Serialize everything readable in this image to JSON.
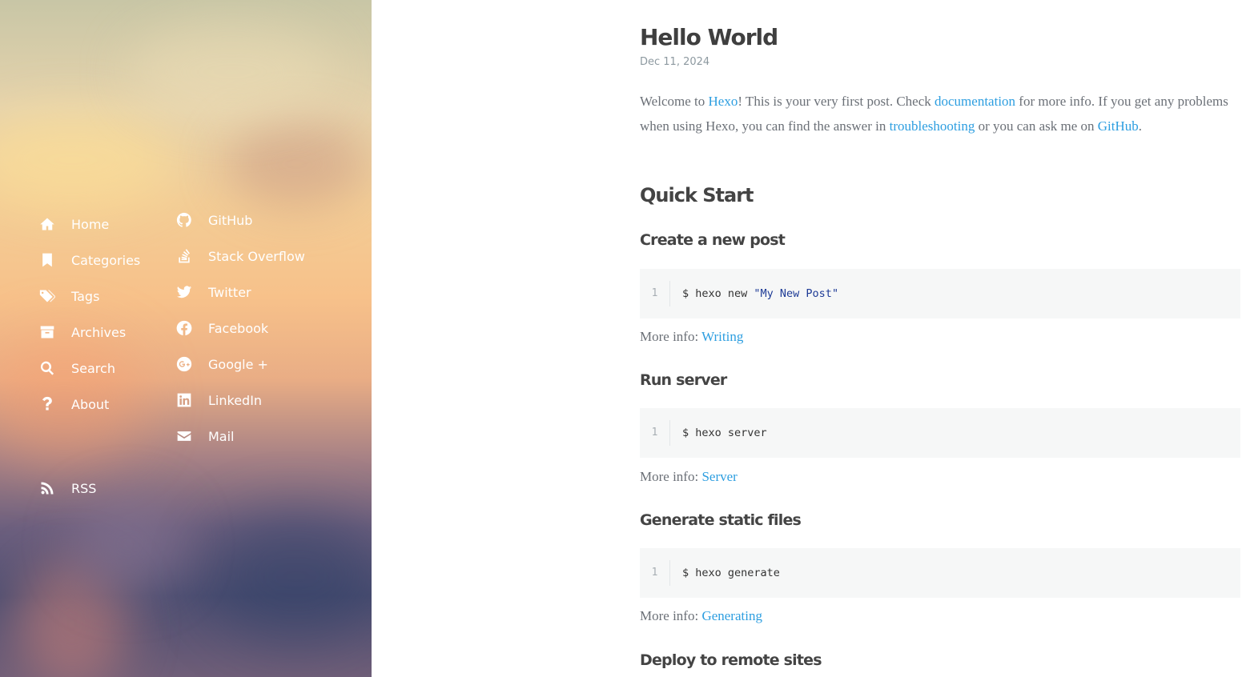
{
  "sidebar": {
    "menu": [
      {
        "label": "Home",
        "icon": "home-icon"
      },
      {
        "label": "Categories",
        "icon": "bookmark-icon"
      },
      {
        "label": "Tags",
        "icon": "tags-icon"
      },
      {
        "label": "Archives",
        "icon": "archive-icon"
      },
      {
        "label": "Search",
        "icon": "search-icon"
      },
      {
        "label": "About",
        "icon": "question-icon"
      }
    ],
    "rss": {
      "label": "RSS",
      "icon": "rss-icon"
    },
    "social": [
      {
        "label": "GitHub",
        "icon": "github-icon"
      },
      {
        "label": "Stack Overflow",
        "icon": "stack-overflow-icon"
      },
      {
        "label": "Twitter",
        "icon": "twitter-icon"
      },
      {
        "label": "Facebook",
        "icon": "facebook-icon"
      },
      {
        "label": "Google +",
        "icon": "google-plus-icon"
      },
      {
        "label": "LinkedIn",
        "icon": "linkedin-icon"
      },
      {
        "label": "Mail",
        "icon": "mail-icon"
      }
    ]
  },
  "post": {
    "title": "Hello World",
    "date": "Dec 11, 2024",
    "intro": {
      "t1": "Welcome to ",
      "link_hexo": "Hexo",
      "t2": "! This is your very first post. Check ",
      "link_docs": "documentation",
      "t3": " for more info. If you get any problems when using Hexo, you can find the answer in ",
      "link_trouble": "troubleshooting",
      "t4": " or you can ask me on ",
      "link_github": "GitHub",
      "t5": "."
    },
    "quick_start": "Quick Start",
    "more_info_label": "More info: ",
    "sections": [
      {
        "heading": "Create a new post",
        "line_no": "1",
        "cmd": "$ hexo new ",
        "cmd_str": "\"My New Post\"",
        "more_link": "Writing"
      },
      {
        "heading": "Run server",
        "line_no": "1",
        "cmd": "$ hexo server",
        "cmd_str": "",
        "more_link": "Server"
      },
      {
        "heading": "Generate static files",
        "line_no": "1",
        "cmd": "$ hexo generate",
        "cmd_str": "",
        "more_link": "Generating"
      }
    ],
    "deploy_heading": "Deploy to remote sites"
  },
  "colors": {
    "link": "#2d9ee0",
    "heading": "#444444",
    "body_text": "#6b7077",
    "code_bg": "#f6f7f7",
    "code_string": "#1e3b96"
  }
}
